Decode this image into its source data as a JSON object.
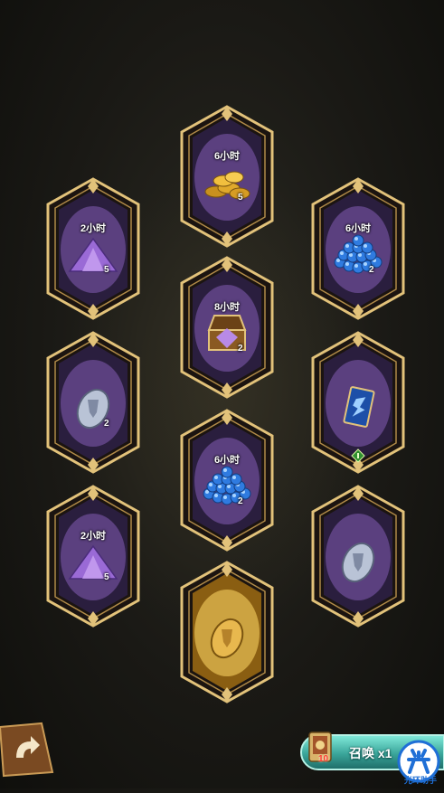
{
  "colors": {
    "frame_gold": "#e2c27a",
    "frame_inner_dark": "#3a2b52",
    "frame_inner_light": "#6d4d96",
    "golden_card": "#c99a2e"
  },
  "nodes": [
    {
      "id": "top-center",
      "label": "6小时",
      "item": "gold-coins",
      "qty": "5",
      "style": "purple"
    },
    {
      "id": "left-1",
      "label": "2小时",
      "item": "purple-dust",
      "qty": "5",
      "style": "purple"
    },
    {
      "id": "right-1",
      "label": "6小时",
      "item": "blue-orbs",
      "qty": "2",
      "style": "purple"
    },
    {
      "id": "center-2",
      "label": "8小时",
      "item": "treasure-chest",
      "qty": "2",
      "style": "purple"
    },
    {
      "id": "left-2",
      "label": "",
      "item": "silver-shield-token",
      "qty": "2",
      "style": "purple"
    },
    {
      "id": "right-2",
      "label": "",
      "item": "blue-card",
      "qty": "",
      "style": "purple"
    },
    {
      "id": "center-3",
      "label": "6小时",
      "item": "blue-orbs",
      "qty": "2",
      "style": "purple"
    },
    {
      "id": "left-3",
      "label": "2小时",
      "item": "purple-dust",
      "qty": "5",
      "style": "purple"
    },
    {
      "id": "right-3",
      "label": "",
      "item": "silver-shield-token",
      "qty": "",
      "style": "purple"
    },
    {
      "id": "bottom-center",
      "label": "",
      "item": "gold-shield-token",
      "qty": "",
      "style": "gold"
    }
  ],
  "summon": {
    "label": "召唤 x1",
    "count": "10"
  },
  "assistant": {
    "text": "光环助手"
  }
}
